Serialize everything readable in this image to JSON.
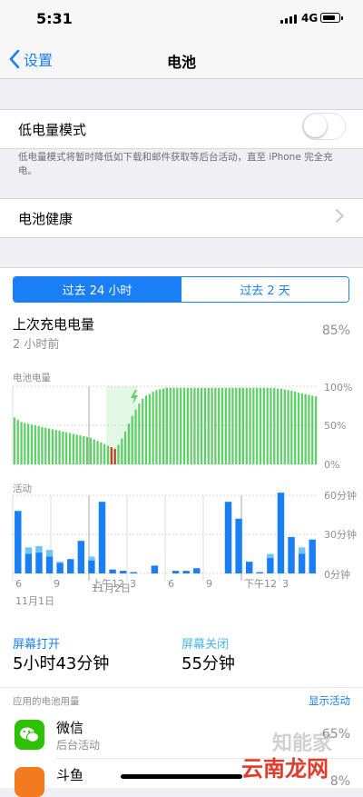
{
  "status": {
    "time": "5:31",
    "network": "4G"
  },
  "nav": {
    "back_label": "设置",
    "title": "电池"
  },
  "low_power": {
    "label": "低电量模式",
    "enabled": false,
    "note": "低电量模式将暂时降低如下载和邮件获取等后台活动，直至 iPhone 完全充电。"
  },
  "health": {
    "label": "电池健康"
  },
  "tabs": {
    "selected": "过去 24 小时",
    "other": "过去 2 天"
  },
  "last_charge": {
    "label": "上次充电电量",
    "ago": "2 小时前",
    "value": "85%"
  },
  "battery_chart": {
    "title": "电池电量",
    "y_labels": [
      "100%",
      "50%",
      "0%"
    ]
  },
  "activity_chart": {
    "title": "活动",
    "y_labels": [
      "60分钟",
      "30分钟",
      "0分钟"
    ],
    "x_labels": [
      "6",
      "9",
      "上午12",
      "3",
      "6",
      "9",
      "下午12",
      "3"
    ],
    "date_labels": [
      "11月1日",
      "11月2日"
    ]
  },
  "screen": {
    "on_label": "屏幕打开",
    "on_value": "5小时43分钟",
    "off_label": "屏幕关闭",
    "off_value": "55分钟"
  },
  "usage": {
    "header": "应用的电池用量",
    "show_activity": "显示活动",
    "apps": [
      {
        "name": "微信",
        "sub": "后台活动",
        "percent": "65%"
      },
      {
        "name": "斗鱼",
        "sub": "",
        "percent": "8%"
      }
    ]
  },
  "watermark": {
    "line1": "知能家",
    "line2": "云南龙网"
  },
  "colors": {
    "accent": "#1a7ef7",
    "battery_green": "#5fd068",
    "screen_on": "#1a7ef7",
    "screen_off": "#6cc6f5",
    "low_red": "#c0392b"
  },
  "chart_data": [
    {
      "type": "bar",
      "title": "电池电量",
      "ylim": [
        0,
        100
      ],
      "ylabel": "%",
      "x": [
        "6",
        "9",
        "上午12",
        "3",
        "6",
        "9",
        "下午12",
        "3"
      ],
      "values": [
        60,
        57,
        54,
        53,
        52,
        51,
        50,
        49,
        48,
        47,
        46,
        45,
        44,
        43,
        42,
        41,
        40,
        39,
        38,
        37,
        36,
        35,
        34,
        32,
        30,
        28,
        26,
        24,
        22,
        20,
        25,
        33,
        42,
        52,
        62,
        70,
        78,
        84,
        88,
        90,
        93,
        95,
        96,
        97,
        98,
        98,
        98,
        98,
        98,
        98,
        98,
        98,
        98,
        98,
        98,
        98,
        98,
        98,
        98,
        98,
        98,
        98,
        98,
        98,
        98,
        98,
        98,
        98,
        98,
        98,
        98,
        98,
        98,
        98,
        98,
        98,
        97,
        97,
        96,
        95,
        94,
        93,
        92,
        91,
        90,
        89,
        88,
        87
      ],
      "charging_range": [
        27,
        36
      ]
    },
    {
      "type": "bar",
      "title": "活动",
      "ylim": [
        0,
        60
      ],
      "ylabel": "分钟",
      "x": [
        "6",
        "9",
        "上午12",
        "3",
        "6",
        "9",
        "下午12",
        "3"
      ],
      "series": [
        {
          "name": "屏幕打开",
          "values": [
            48,
            15,
            16,
            13,
            8,
            11,
            25,
            10,
            55,
            3,
            2,
            1,
            0,
            6,
            0,
            2,
            2,
            4,
            0,
            0,
            55,
            42,
            9,
            1,
            12,
            62,
            28,
            15,
            26
          ]
        },
        {
          "name": "屏幕关闭",
          "values": [
            0,
            5,
            5,
            5,
            1,
            0,
            0,
            3,
            0,
            0,
            0,
            0,
            0,
            0,
            0,
            0,
            0,
            0,
            0,
            0,
            0,
            0,
            0,
            0,
            3,
            0,
            0,
            5,
            0
          ]
        }
      ]
    }
  ]
}
